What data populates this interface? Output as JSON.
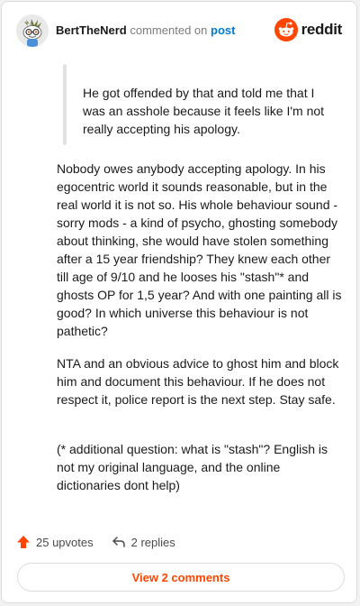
{
  "header": {
    "username": "BertTheNerd",
    "verb": "commented on",
    "post_link": "post",
    "brand": "reddit"
  },
  "comment": {
    "quote": "He got offended by that and told me that I was an asshole because it feels like I'm not really accepting his apology.",
    "paragraphs": [
      "Nobody owes anybody accepting apology. In his egocentric world it sounds reasonable, but in the real world it is not so. His whole behaviour sound - sorry mods - a kind of psycho, ghosting somebody about thinking, she would have stolen something after a 15 year friendship? They knew each other till age of 9/10 and he looses his \"stash\"* and ghosts OP for 1,5 year? And with one painting all is good? In which universe this behaviour is not pathetic?",
      "NTA and an obvious advice to ghost him and block him and document this behaviour. If he does not respect it, police report is the next step. Stay safe.",
      "(* additional question: what is \"stash\"? English is not my original language, and the online dictionaries dont help)"
    ]
  },
  "actions": {
    "upvotes": "25 upvotes",
    "replies": "2 replies",
    "view_comments": "View 2 comments"
  },
  "colors": {
    "brand": "#ff4500",
    "link": "#0079d3",
    "text": "#1a1a1b"
  }
}
